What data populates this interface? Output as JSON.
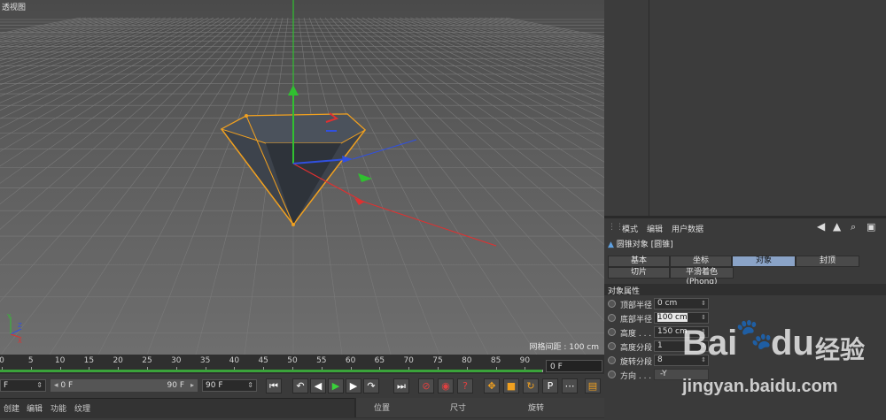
{
  "viewport": {
    "title": "透视图",
    "grid_info": "网格间距 : 100 cm"
  },
  "timeline": {
    "ticks": [
      "0",
      "5",
      "10",
      "15",
      "20",
      "25",
      "30",
      "35",
      "40",
      "45",
      "50",
      "55",
      "60",
      "65",
      "70",
      "75",
      "80",
      "85",
      "90"
    ],
    "current_frame": "0 F"
  },
  "transport": {
    "start_field": "F",
    "range_start": "0 F",
    "range_end": "90 F",
    "end_field": "90 F"
  },
  "bottom_menu": {
    "items": [
      "创建",
      "编辑",
      "功能",
      "纹理"
    ]
  },
  "coord_header": {
    "position": "位置",
    "size": "尺寸",
    "rotation": "旋转"
  },
  "attributes": {
    "menu": [
      "模式",
      "编辑",
      "用户数据"
    ],
    "object_title": "圆锥对象 [圆锥]",
    "tabs_row1": [
      {
        "label": "基本",
        "active": false
      },
      {
        "label": "坐标",
        "active": false
      },
      {
        "label": "对象",
        "active": true
      },
      {
        "label": "封顶",
        "active": false
      }
    ],
    "tabs_row2": [
      {
        "label": "切片",
        "active": false
      },
      {
        "label": "平滑着色(Phong)",
        "active": false
      }
    ],
    "section_title": "对象属性",
    "props": [
      {
        "label": "顶部半径",
        "value": "0 cm"
      },
      {
        "label": "底部半径",
        "value": "100 cm"
      },
      {
        "label": "高度 . . .",
        "value": "150 cm"
      },
      {
        "label": "高度分段",
        "value": "1"
      },
      {
        "label": "旋转分段",
        "value": "8"
      },
      {
        "label": "方向 . . .",
        "value": "-Y"
      }
    ]
  },
  "watermark": {
    "brand": "Bai",
    "brand2": "du",
    "cn": "经验",
    "url": "jingyan.baidu.com"
  },
  "colors": {
    "axis_x": "#e03030",
    "axis_y": "#30c030",
    "axis_z": "#3050e0",
    "selection": "#f0a020",
    "active_tab": "#8aa3c7"
  }
}
